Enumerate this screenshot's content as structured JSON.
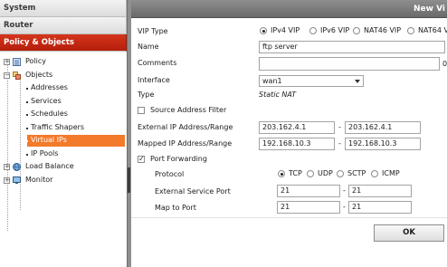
{
  "nav": {
    "sections": [
      "System",
      "Router",
      "Policy & Objects"
    ],
    "tree": {
      "policy": "Policy",
      "objects": "Objects",
      "object_items": [
        "Addresses",
        "Services",
        "Schedules",
        "Traffic Shapers",
        "Virtual IPs",
        "IP Pools"
      ],
      "selected": "Virtual IPs",
      "load_balance": "Load Balance",
      "monitor": "Monitor"
    }
  },
  "dialog": {
    "title": "New Vi",
    "vip_type": {
      "label": "VIP Type",
      "options": [
        "IPv4 VIP",
        "IPv6 VIP",
        "NAT46 VIP",
        "NAT64 V"
      ],
      "selected": "IPv4 VIP"
    },
    "name": {
      "label": "Name",
      "value": "ftp server"
    },
    "comments": {
      "label": "Comments",
      "value": "",
      "counter": "0"
    },
    "interface": {
      "label": "Interface",
      "value": "wan1"
    },
    "type": {
      "label": "Type",
      "value": "Static NAT"
    },
    "source_address_filter": {
      "label": "Source Address Filter",
      "checked": false
    },
    "external_ip": {
      "label": "External IP Address/Range",
      "from": "203.162.4.1",
      "dash": "-",
      "to": "203.162.4.1"
    },
    "mapped_ip": {
      "label": "Mapped IP Address/Range",
      "from": "192.168.10.3",
      "dash": "-",
      "to": "192.168.10.3"
    },
    "port_forwarding": {
      "label": "Port Forwarding",
      "checked": true,
      "protocol": {
        "label": "Protocol",
        "options": [
          "TCP",
          "UDP",
          "SCTP",
          "ICMP"
        ],
        "selected": "TCP"
      },
      "external_service_port": {
        "label": "External Service Port",
        "from": "21",
        "dash": "-",
        "to": "21"
      },
      "map_to_port": {
        "label": "Map to Port",
        "from": "21",
        "dash": "-",
        "to": "21"
      }
    },
    "ok_label": "OK"
  },
  "colors": {
    "accent": "#c4290f",
    "selection": "#f3792b",
    "titlebar": "#7a7a7a"
  }
}
